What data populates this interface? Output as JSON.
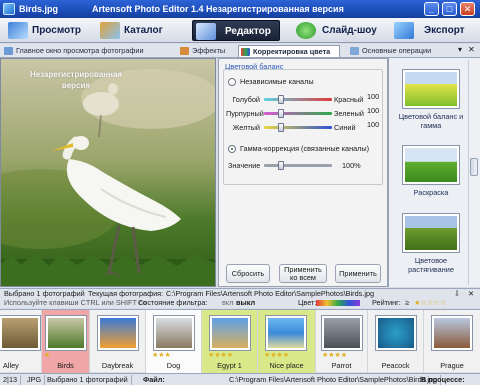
{
  "window": {
    "file_name": "Birds.jpg",
    "title": "Artensoft Photo Editor 1.4  Незарегистрированная версия",
    "min": "_",
    "max": "□",
    "close": "✕"
  },
  "modes": [
    {
      "label": "Просмотр",
      "icon": "preview-icon"
    },
    {
      "label": "Каталог",
      "icon": "catalog-icon"
    },
    {
      "label": "Редактор",
      "icon": "editor-icon"
    },
    {
      "label": "Слайд-шоу",
      "icon": "slideshow-icon"
    },
    {
      "label": "Экспорт",
      "icon": "export-icon"
    }
  ],
  "subtabs": [
    {
      "label": "Главное окно просмотра фотографии"
    },
    {
      "label": "Эффекты"
    },
    {
      "label": "Корректировка цвета"
    },
    {
      "label": "Основные операции"
    }
  ],
  "tab_controls": {
    "dropdown": "▾",
    "close": "✕"
  },
  "watermark": "Незарегистрированная версия",
  "color_balance": {
    "section_title": "Цветовой баланс",
    "independent_channels": "Независимые каналы",
    "channels": [
      {
        "left": "Голубой",
        "right": "Красный",
        "value": "100",
        "track_color": "#e23a3a"
      },
      {
        "left": "Пурпурный",
        "right": "Зеленый",
        "value": "100",
        "track_color": "#2fa84a"
      },
      {
        "left": "Желтый",
        "right": "Синий",
        "value": "100",
        "track_color": "#2f52d8"
      }
    ],
    "gamma_label": "Гамма-коррекция (связанные каналы)",
    "value_label": "Значение",
    "value": "100%",
    "reset": "Сбросить",
    "apply_all_line1": "Применить",
    "apply_all_line2": "ко всем",
    "apply": "Применить"
  },
  "presets": [
    {
      "label": "Цветовой баланс и гамма"
    },
    {
      "label": "Раскраска"
    },
    {
      "label": "Цветовое растягивание"
    }
  ],
  "info": {
    "selected": "Выбрано 1 фотографий",
    "current_label": "Текущая фотография:",
    "current_path": "C:\\Program Files\\Artensoft Photo Editor\\SamplePhotos\\Birds.jpg",
    "pin": "⇩",
    "close": "✕"
  },
  "hint": {
    "text": "Используйте клавиши CTRL или SHIFT со",
    "filter_label": "Состояние фильтра:",
    "filter_on": "вкл",
    "filter_off": "выкл",
    "color_label": "Цвет:",
    "rating_label": "Рейтинг:",
    "rating_op": "≥"
  },
  "filmstrip": [
    {
      "name": "Alley"
    },
    {
      "name": "Birds"
    },
    {
      "name": "Daybreak"
    },
    {
      "name": "Dog"
    },
    {
      "name": "Egypt 1"
    },
    {
      "name": "Nice place"
    },
    {
      "name": "Parrot"
    },
    {
      "name": "Peacock"
    },
    {
      "name": "Prague"
    }
  ],
  "status": {
    "size": "2|13",
    "format": "JPG",
    "selected": "Выбрано 1 фотографий",
    "file_label": "Файл:",
    "file_path": "C:\\Program Files\\Artensoft Photo Editor\\SamplePhotos\\Birds.jpg",
    "progress_label": "В процессе:"
  },
  "colors": {
    "accent": "#2a56b6",
    "title_bar": "#1c4db8",
    "active_mode": "#1a2236"
  }
}
